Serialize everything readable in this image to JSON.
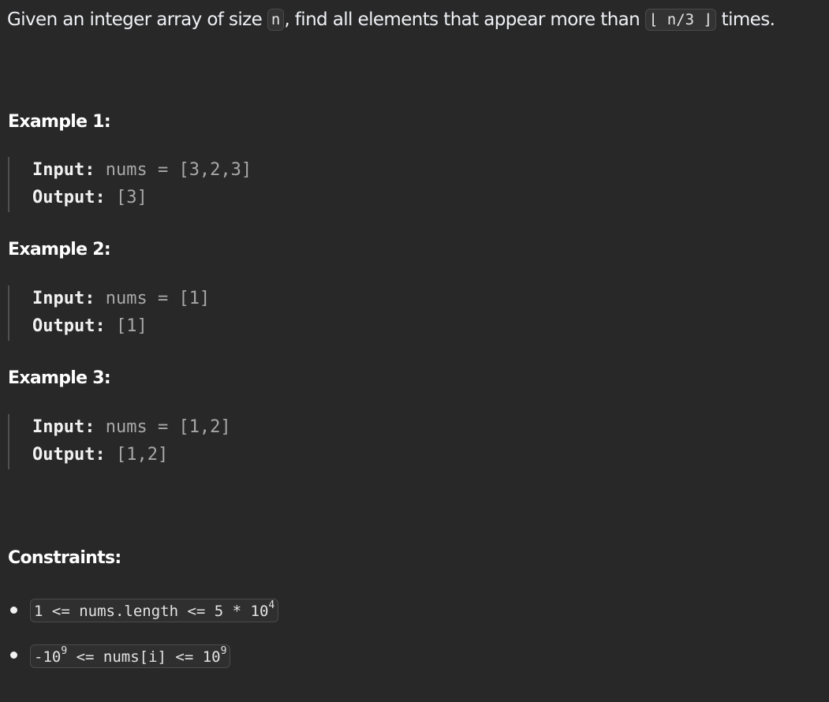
{
  "description": {
    "text_before": "Given an integer array of size ",
    "code_n": "n",
    "text_middle": ", find all elements that appear more than ",
    "code_floor": "⌊ n/3 ⌋",
    "text_after": " times."
  },
  "examples": [
    {
      "title": "Example 1:",
      "input_label": "Input:",
      "input_value": " nums = [3,2,3]",
      "output_label": "Output:",
      "output_value": " [3]"
    },
    {
      "title": "Example 2:",
      "input_label": "Input:",
      "input_value": " nums = [1]",
      "output_label": "Output:",
      "output_value": " [1]"
    },
    {
      "title": "Example 3:",
      "input_label": "Input:",
      "input_value": " nums = [1,2]",
      "output_label": "Output:",
      "output_value": " [1,2]"
    }
  ],
  "constraints": {
    "title": "Constraints:",
    "items": [
      {
        "before": "1 <= nums.length <= 5 * 10",
        "sup": "4",
        "after": ""
      },
      {
        "before": "-10",
        "sup": "9",
        "after": " <= nums[i] <= 10",
        "sup2": "9"
      }
    ]
  }
}
